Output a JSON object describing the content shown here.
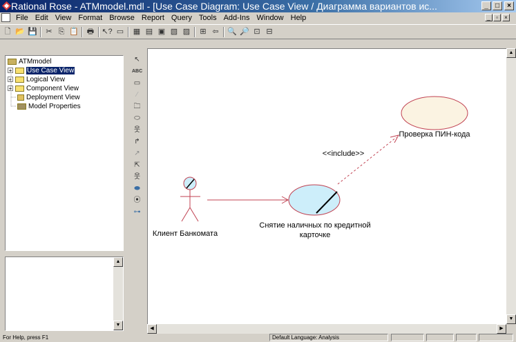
{
  "window": {
    "title": "Rational Rose - ATMmodel.mdl - [Use Case Diagram: Use Case View / Диаграмма вариантов ис...",
    "buttons": [
      "_",
      "□",
      "×"
    ]
  },
  "menu": [
    "File",
    "Edit",
    "View",
    "Format",
    "Browse",
    "Report",
    "Query",
    "Tools",
    "Add-Ins",
    "Window",
    "Help"
  ],
  "browser": {
    "root": "ATMmodel",
    "items": [
      {
        "label": "Use Case View",
        "selected": true,
        "expand": "+"
      },
      {
        "label": "Logical View",
        "expand": "+"
      },
      {
        "label": "Component View",
        "expand": "+"
      },
      {
        "label": "Deployment View"
      },
      {
        "label": "Model Properties"
      }
    ]
  },
  "toolbox": {
    "text_tool": "ABC"
  },
  "diagram": {
    "actor": "Клиент Банкомата",
    "usecase_main_line1": "Снятие наличных по кредитной",
    "usecase_main_line2": "карточке",
    "usecase_included": "Проверка ПИН-кода",
    "stereotype": "<<include>>"
  },
  "status": {
    "help": "For Help, press F1",
    "language": "Default Language: Analysis"
  }
}
